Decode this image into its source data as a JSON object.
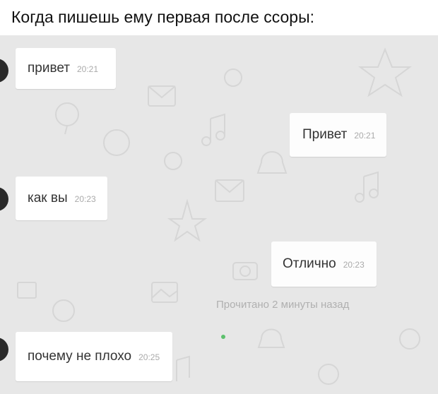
{
  "caption": "Когда пишешь ему первая после ссоры:",
  "messages": [
    {
      "text": "привет",
      "time": "20:21",
      "direction": "in"
    },
    {
      "text": "Привет",
      "time": "20:21",
      "direction": "out"
    },
    {
      "text": "как вы",
      "time": "20:23",
      "direction": "in"
    },
    {
      "text": "Отлично",
      "time": "20:23",
      "direction": "out"
    },
    {
      "text": "почему не плохо",
      "time": "20:25",
      "direction": "in"
    }
  ],
  "read_status": "Прочитано 2 минуты назад",
  "colors": {
    "chat_background": "#e7e7e7",
    "bubble": "#ffffff",
    "online_indicator": "#5cc06c"
  }
}
